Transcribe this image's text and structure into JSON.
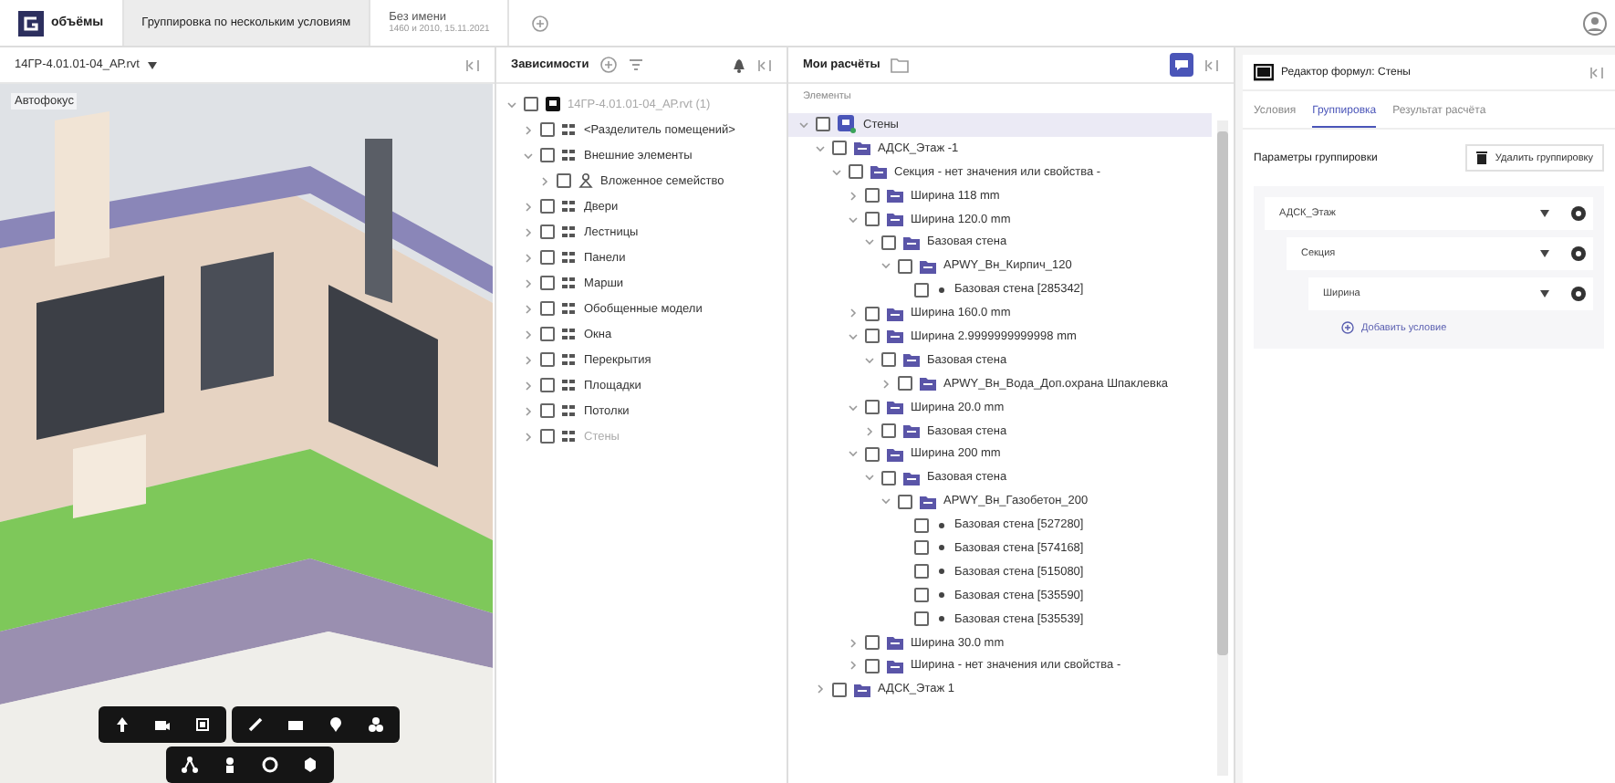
{
  "top_bar": {
    "brand": "объёмы",
    "tabs": [
      {
        "label": "Группировка по нескольким условиям",
        "selected": true
      },
      {
        "label": "Без имени",
        "subtitle": "1460 и 2010, 15.11.2021",
        "selected": false
      }
    ]
  },
  "viewer": {
    "file": "14ГР-4.01.01-04_АР.rvt",
    "autofocus": "Автофокус",
    "kind": "picture"
  },
  "dependencies": {
    "title": "Зависимости",
    "tree": [
      {
        "label": "14ГР-4.01.01-04_АР.rvt (1)",
        "kind": "model",
        "checked": false,
        "disabled": true,
        "expanded": true,
        "children": [
          {
            "label": "<Разделитель помещений>",
            "kind": "category",
            "checked": false,
            "disabled": false,
            "expanded": false
          },
          {
            "label": "Внешние элементы",
            "kind": "category",
            "checked": false,
            "disabled": false,
            "expanded": true,
            "children": [
              {
                "label": "Вложенное семейство",
                "kind": "family",
                "checked": false,
                "disabled": false,
                "expanded": false
              }
            ]
          },
          {
            "label": "Двери",
            "kind": "category",
            "checked": false,
            "disabled": false,
            "expanded": false
          },
          {
            "label": "Лестницы",
            "kind": "category",
            "checked": false,
            "disabled": false,
            "expanded": false
          },
          {
            "label": "Панели",
            "kind": "category",
            "checked": false,
            "disabled": false,
            "expanded": false
          },
          {
            "label": "Марши",
            "kind": "category",
            "checked": false,
            "disabled": false,
            "expanded": false
          },
          {
            "label": "Обобщенные модели",
            "kind": "category",
            "checked": false,
            "disabled": false,
            "expanded": false
          },
          {
            "label": "Окна",
            "kind": "category",
            "checked": false,
            "disabled": false,
            "expanded": false
          },
          {
            "label": "Перекрытия",
            "kind": "category",
            "checked": false,
            "disabled": false,
            "expanded": false
          },
          {
            "label": "Площадки",
            "kind": "category",
            "checked": false,
            "disabled": false,
            "expanded": false
          },
          {
            "label": "Потолки",
            "kind": "category",
            "checked": false,
            "disabled": false,
            "expanded": false
          },
          {
            "label": "Стены",
            "kind": "category",
            "checked": false,
            "disabled": true,
            "expanded": false
          }
        ]
      }
    ]
  },
  "calculations": {
    "title": "Мои расчёты",
    "subtitle": "Элементы",
    "tree": [
      {
        "label": "Стены",
        "kind": "root",
        "checked": false,
        "selected": true,
        "expanded": true,
        "children": [
          {
            "label": "АДСК_Этаж -1",
            "kind": "folder",
            "checked": false,
            "selected": false,
            "expanded": true,
            "children": [
              {
                "label": "Секция - нет значения или свойства -",
                "kind": "folder",
                "checked": false,
                "selected": false,
                "expanded": true,
                "children": [
                  {
                    "label": "Ширина 118 mm",
                    "kind": "folder",
                    "checked": false,
                    "selected": false,
                    "expanded": false
                  },
                  {
                    "label": "Ширина 120.0 mm",
                    "kind": "folder",
                    "checked": false,
                    "selected": false,
                    "expanded": true,
                    "children": [
                      {
                        "label": "Базовая стена",
                        "kind": "folder",
                        "checked": false,
                        "selected": false,
                        "expanded": true,
                        "children": [
                          {
                            "label": "APWY_Вн_Кирпич_120",
                            "kind": "folder",
                            "checked": false,
                            "selected": false,
                            "expanded": true,
                            "children": [
                              {
                                "label": "Базовая стена [285342]",
                                "kind": "element",
                                "checked": false,
                                "selected": false
                              }
                            ]
                          }
                        ]
                      }
                    ]
                  },
                  {
                    "label": "Ширина 160.0 mm",
                    "kind": "folder",
                    "checked": false,
                    "selected": false,
                    "expanded": false
                  },
                  {
                    "label": "Ширина 2.9999999999998 mm",
                    "kind": "folder",
                    "checked": false,
                    "selected": false,
                    "expanded": true,
                    "children": [
                      {
                        "label": "Базовая стена",
                        "kind": "folder",
                        "checked": false,
                        "selected": false,
                        "expanded": true,
                        "children": [
                          {
                            "label": "APWY_Вн_Вода_Доп.охрана Шпаклевка",
                            "kind": "folder",
                            "checked": false,
                            "selected": false,
                            "expanded": false
                          }
                        ]
                      }
                    ]
                  },
                  {
                    "label": "Ширина 20.0 mm",
                    "kind": "folder",
                    "checked": false,
                    "selected": false,
                    "expanded": true,
                    "children": [
                      {
                        "label": "Базовая стена",
                        "kind": "folder",
                        "checked": false,
                        "selected": false,
                        "expanded": false
                      }
                    ]
                  },
                  {
                    "label": "Ширина 200 mm",
                    "kind": "folder",
                    "checked": false,
                    "selected": false,
                    "expanded": true,
                    "children": [
                      {
                        "label": "Базовая стена",
                        "kind": "folder",
                        "checked": false,
                        "selected": false,
                        "expanded": true,
                        "children": [
                          {
                            "label": "APWY_Вн_Газобетон_200",
                            "kind": "folder",
                            "checked": false,
                            "selected": false,
                            "expanded": true,
                            "children": [
                              {
                                "label": "Базовая стена [527280]",
                                "kind": "element",
                                "checked": false,
                                "selected": false
                              },
                              {
                                "label": "Базовая стена [574168]",
                                "kind": "element",
                                "checked": false,
                                "selected": false
                              },
                              {
                                "label": "Базовая стена [515080]",
                                "kind": "element",
                                "checked": false,
                                "selected": false
                              },
                              {
                                "label": "Базовая стена [535590]",
                                "kind": "element",
                                "checked": false,
                                "selected": false
                              },
                              {
                                "label": "Базовая стена [535539]",
                                "kind": "element",
                                "checked": false,
                                "selected": false
                              }
                            ]
                          }
                        ]
                      }
                    ]
                  },
                  {
                    "label": "Ширина 30.0 mm",
                    "kind": "folder",
                    "checked": false,
                    "selected": false,
                    "expanded": false
                  },
                  {
                    "label": "Ширина - нет значения или свойства -",
                    "kind": "folder",
                    "checked": false,
                    "selected": false,
                    "expanded": false
                  }
                ]
              }
            ]
          },
          {
            "label": "АДСК_Этаж 1",
            "kind": "folder",
            "checked": false,
            "selected": false,
            "expanded": false
          }
        ]
      }
    ]
  },
  "formula_editor": {
    "title": "Редактор формул: Стены",
    "tabs": [
      {
        "label": "Условия",
        "selected": false
      },
      {
        "label": "Группировка",
        "selected": true
      },
      {
        "label": "Результат расчёта",
        "selected": false
      }
    ],
    "section": "Параметры группировки",
    "delete_button": "Удалить группировку",
    "grouping": [
      {
        "value": "АДСК_Этаж",
        "children": [
          {
            "value": "Секция",
            "children": [
              {
                "value": "Ширина"
              }
            ]
          }
        ]
      }
    ],
    "add_condition": "Добавить условие"
  }
}
